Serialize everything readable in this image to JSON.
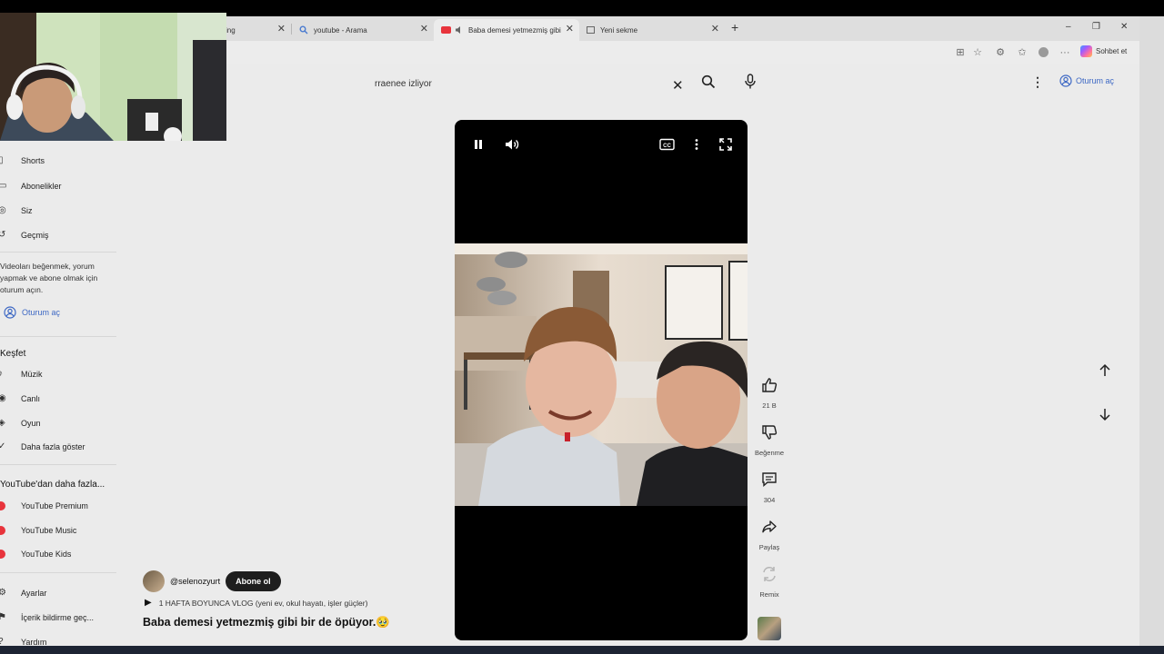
{
  "tabs": [
    {
      "title": "ing",
      "active": false
    },
    {
      "title": "youtube - Arama",
      "active": false
    },
    {
      "title": "Baba demesi yetmezmiş gibi",
      "active": true
    },
    {
      "title": "Yeni sekme",
      "active": false
    }
  ],
  "browser": {
    "new_tab": "+",
    "copilot_label": "Sohbet et",
    "win_minimize": "–",
    "win_restore": "❐",
    "win_close": "✕"
  },
  "header": {
    "search_value": "rraenee izliyor",
    "signin_label": "Oturum aç"
  },
  "sidebar": {
    "top_items": [
      {
        "label": "Shorts",
        "icon": "shorts-icon"
      },
      {
        "label": "Abonelikler",
        "icon": "subscriptions-icon"
      },
      {
        "label": "Siz",
        "icon": "you-icon"
      },
      {
        "label": "Geçmiş",
        "icon": "history-icon"
      }
    ],
    "signin_message": [
      "Videoları beğenmek, yorum",
      "yapmak ve abone olmak için",
      "oturum açın."
    ],
    "signin_label": "Oturum aç",
    "explore_heading": "Keşfet",
    "explore_items": [
      {
        "label": "Müzik",
        "icon": "music-icon"
      },
      {
        "label": "Canlı",
        "icon": "live-icon"
      },
      {
        "label": "Oyun",
        "icon": "gaming-icon"
      },
      {
        "label": "Daha fazla göster",
        "icon": "chevron-down-icon"
      }
    ],
    "more_heading": "YouTube'dan daha fazla...",
    "more_items": [
      {
        "label": "YouTube Premium"
      },
      {
        "label": "YouTube Music"
      },
      {
        "label": "YouTube Kids"
      }
    ],
    "bottom_items": [
      {
        "label": "Ayarlar",
        "icon": "settings-icon"
      },
      {
        "label": "İçerik bildirme geç...",
        "icon": "flag-icon"
      },
      {
        "label": "Yardım",
        "icon": "help-icon"
      }
    ]
  },
  "video": {
    "channel": "@selenozyurt",
    "subscribe_label": "Abone ol",
    "playlist": "1 HAFTA BOYUNCA VLOG (yeni ev, okul hayatı, işler güçler)",
    "title": "Baba demesi yetmezmiş gibi bir de öpüyor.🥹"
  },
  "actions": {
    "like_count": "21 B",
    "dislike_label": "Beğenme",
    "comment_count": "304",
    "share_label": "Paylaş",
    "remix_label": "Remix"
  },
  "colors": {
    "accent_blue": "#3d68c4",
    "youtube_red": "#e8343c",
    "page_bg": "#ebebeb"
  }
}
